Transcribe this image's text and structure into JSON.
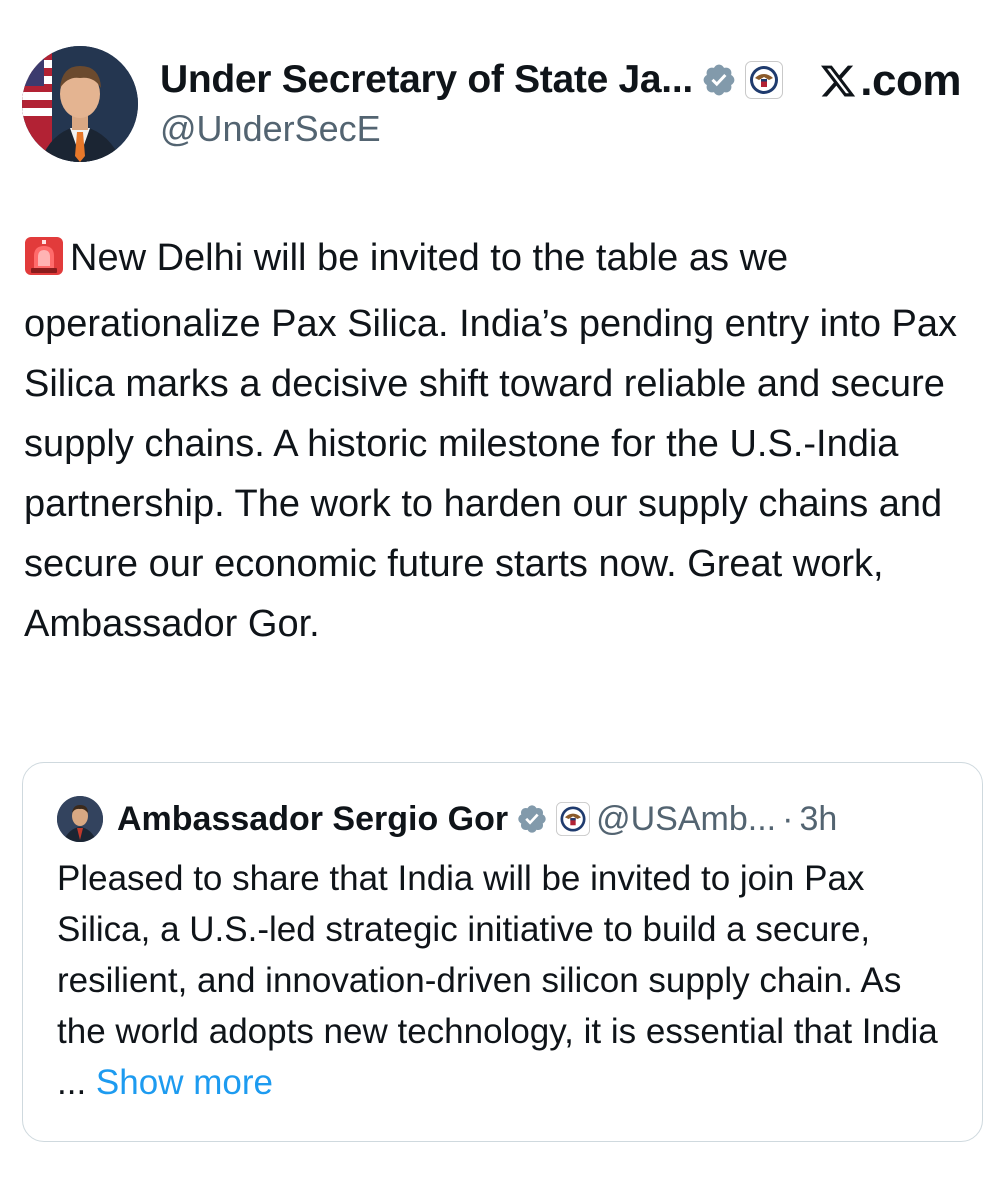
{
  "author": {
    "display_name": "Under Secretary of State Ja...",
    "handle": "@UnderSecE",
    "avatar_icon": "profile-photo"
  },
  "brand": {
    "icon": "x-logo-icon",
    "label": ".com"
  },
  "tweet": {
    "emoji_icon": "police-siren-icon",
    "text": "New Delhi will be invited to the table as we operationalize Pax Silica. India’s pending entry into Pax Silica marks a decisive shift toward reliable and secure supply chains. A historic milestone for the U.S.-India partnership. The work to harden our supply chains and secure our economic future starts now. Great work, Ambassador Gor."
  },
  "quoted_tweet": {
    "display_name": "Ambassador Sergio Gor",
    "handle": "@USAmb...",
    "separator": "·",
    "time": "3h",
    "text": "Pleased to share that India will be invited to join Pax Silica, a U.S.-led strategic initiative to build a secure, resilient, and innovation-driven silicon supply chain. As the world adopts new technology, it is essential that India ...",
    "show_more_label": "Show more"
  },
  "colors": {
    "verified_gray": "#829aab",
    "link_blue": "#1d9bf0",
    "border": "#cfd9de",
    "secondary_text": "#536471"
  }
}
